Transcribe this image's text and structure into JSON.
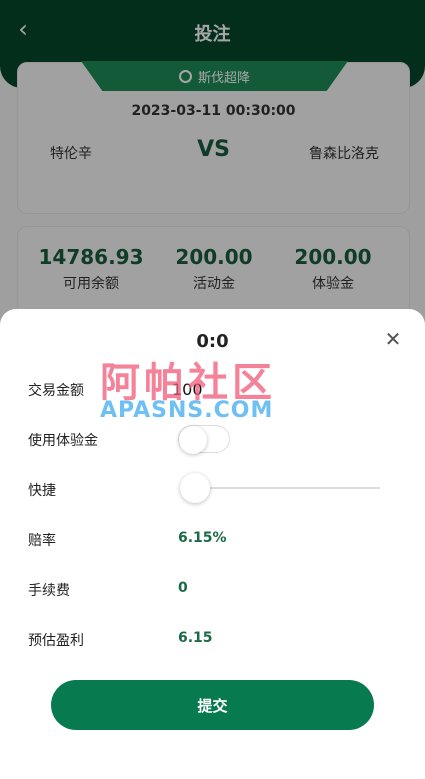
{
  "header": {
    "title": "投注",
    "back_icon": "chevron-left-icon"
  },
  "match": {
    "league": "斯伐超降",
    "time": "2023-03-11 00:30:00",
    "home": "特伦辛",
    "vs": "VS",
    "away": "鲁森比洛克"
  },
  "balances": [
    {
      "value": "14786.93",
      "label": "可用余额"
    },
    {
      "value": "200.00",
      "label": "活动金"
    },
    {
      "value": "200.00",
      "label": "体验金"
    }
  ],
  "sheet": {
    "score": "0:0",
    "amount_label": "交易金额",
    "amount_value": "100",
    "trial_label": "使用体验金",
    "trial_enabled": false,
    "quick_label": "快捷",
    "quick_slider_fraction": 0,
    "odds_label": "赔率",
    "odds_value": "6.15%",
    "fee_label": "手续费",
    "fee_value": "0",
    "profit_label": "预估盈利",
    "profit_value": "6.15",
    "submit_label": "提交"
  },
  "watermark": {
    "cn": "阿帕社区",
    "en": "APASNS.COM"
  },
  "colors": {
    "primary": "#05472c",
    "accent": "#087a4f",
    "value_green": "#1a6b45"
  }
}
